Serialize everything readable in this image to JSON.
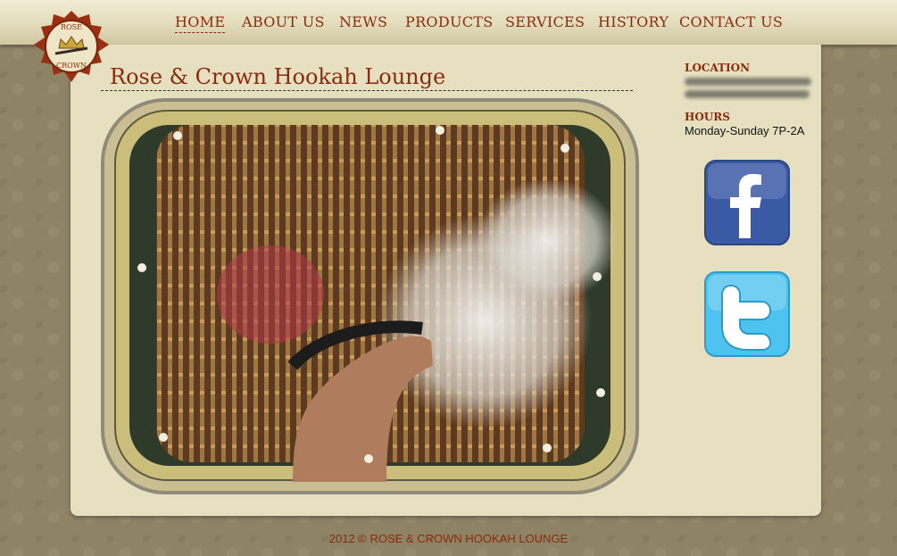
{
  "nav": {
    "items": [
      {
        "label": "HOME",
        "active": true
      },
      {
        "label": "ABOUT US"
      },
      {
        "label": "NEWS"
      },
      {
        "label": "PRODUCTS"
      },
      {
        "label": "SERVICES"
      },
      {
        "label": "HISTORY"
      },
      {
        "label": "CONTACT US"
      }
    ]
  },
  "logo": {
    "top_text": "ROSE",
    "bottom_text": "CROWN"
  },
  "main": {
    "title": "Rose & Crown Hookah Lounge"
  },
  "sidebar": {
    "location_heading": "LOCATION",
    "hours_heading": "HOURS",
    "hours": "Monday-Sunday 7P-2A"
  },
  "social": [
    {
      "icon": "facebook-icon",
      "glyph": "f",
      "color": "#3b5aa6"
    },
    {
      "icon": "twitter-icon",
      "glyph": "t",
      "color": "#4fc3ef"
    }
  ],
  "footer": {
    "text": "2012 © ROSE & CROWN HOOKAH LOUNGE"
  },
  "colors": {
    "accent": "#8a2b0c",
    "panel": "#e6e0c1",
    "background": "#8f8366"
  }
}
